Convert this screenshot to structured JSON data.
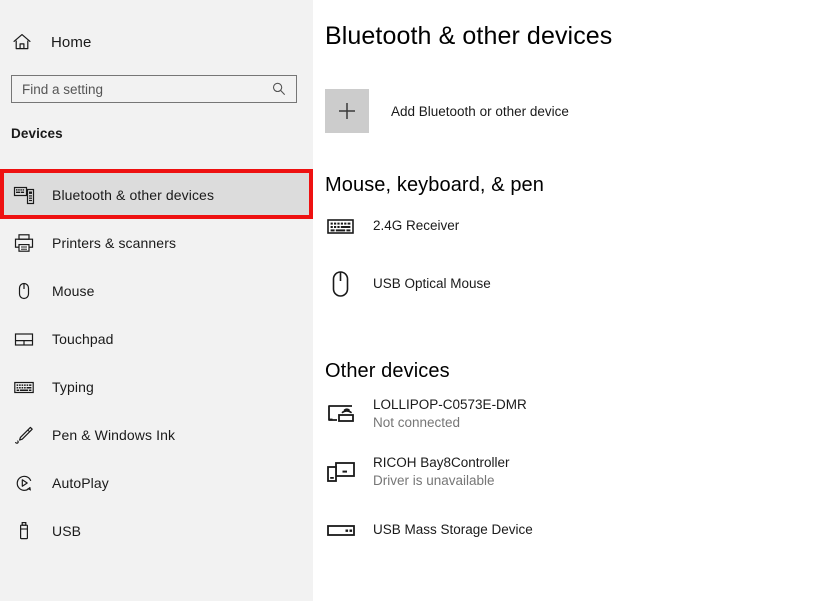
{
  "sidebar": {
    "home": {
      "label": "Home",
      "icon": "home-icon"
    },
    "search": {
      "placeholder": "Find a setting",
      "value": "",
      "icon": "search-icon"
    },
    "section_title": "Devices",
    "items": [
      {
        "label": "Bluetooth & other devices",
        "icon": "bluetooth-devices-icon",
        "selected": true
      },
      {
        "label": "Printers & scanners",
        "icon": "printer-icon",
        "selected": false
      },
      {
        "label": "Mouse",
        "icon": "mouse-icon",
        "selected": false
      },
      {
        "label": "Touchpad",
        "icon": "touchpad-icon",
        "selected": false
      },
      {
        "label": "Typing",
        "icon": "keyboard-icon",
        "selected": false
      },
      {
        "label": "Pen & Windows Ink",
        "icon": "pen-icon",
        "selected": false
      },
      {
        "label": "AutoPlay",
        "icon": "autoplay-icon",
        "selected": false
      },
      {
        "label": "USB",
        "icon": "usb-icon",
        "selected": false
      }
    ],
    "highlight_color": "#ee1111"
  },
  "main": {
    "title": "Bluetooth & other devices",
    "add_device": {
      "label": "Add Bluetooth or other device",
      "icon": "plus-icon"
    },
    "groups": [
      {
        "heading": "Mouse, keyboard, & pen",
        "devices": [
          {
            "name": "2.4G Receiver",
            "status": "",
            "icon": "keyboard-icon"
          },
          {
            "name": "USB Optical Mouse",
            "status": "",
            "icon": "mouse-icon"
          }
        ]
      },
      {
        "heading": "Other devices",
        "devices": [
          {
            "name": "LOLLIPOP-C0573E-DMR",
            "status": "Not connected",
            "icon": "cast-display-icon"
          },
          {
            "name": "RICOH Bay8Controller",
            "status": "Driver is unavailable",
            "icon": "phone-monitor-icon"
          },
          {
            "name": "USB Mass Storage Device",
            "status": "",
            "icon": "storage-drive-icon"
          }
        ]
      }
    ]
  }
}
